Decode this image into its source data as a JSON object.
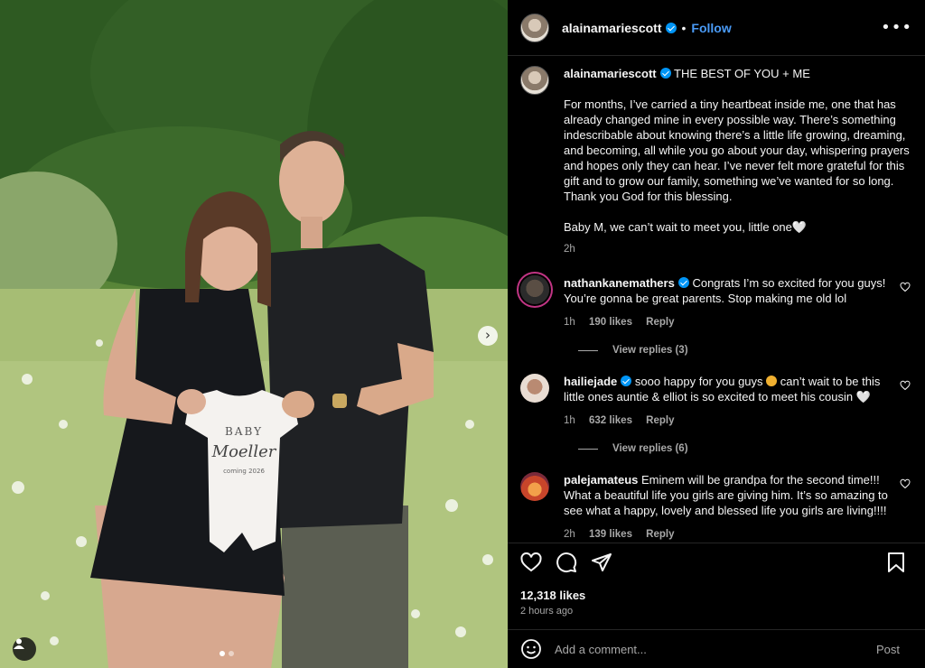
{
  "post": {
    "username": "alainamariescott",
    "follow_label": "Follow",
    "separator": "•",
    "more_label": "•••",
    "caption_title": "THE BEST OF YOU + ME",
    "caption_body": "For months, I’ve carried a tiny heartbeat inside me, one that has already changed mine in every possible way. There’s something indescribable about knowing there’s a little life growing, dreaming, and becoming, all while you go about your day, whispering prayers and hopes only they can hear. I’ve never felt more grateful for this gift and to grow our family, something we’ve wanted for so long. Thank you God for this blessing.\n\nBaby M, we can’t wait to meet you, little one🤍",
    "caption_time": "2h",
    "likes": "12,318 likes",
    "posted_ago": "2 hours ago"
  },
  "photo": {
    "onesie_line1": "BABY",
    "onesie_line2": "Moeller",
    "onesie_line3": "coming 2026",
    "next_arrow": "›"
  },
  "comments": [
    {
      "username": "nathankanemathers",
      "verified": true,
      "text": "Congrats I’m so excited for you guys! You’re gonna be great parents. Stop making me old lol",
      "time": "1h",
      "likes": "190 likes",
      "reply": "Reply",
      "view_replies": "View replies (3)"
    },
    {
      "username": "hailiejade",
      "verified": true,
      "text_a": "sooo happy for you guys",
      "text_b": "can’t wait to be this little ones auntie & elliot is so excited to meet his cousin 🤍",
      "time": "1h",
      "likes": "632 likes",
      "reply": "Reply",
      "view_replies": "View replies (6)"
    },
    {
      "username": "palejamateus",
      "verified": false,
      "text": "Eminem will be grandpa for the second time!!! What a beautiful life you girls are giving him. It’s so amazing to see what a happy, lovely and blessed life you girls are living!!!!",
      "time": "2h",
      "likes": "139 likes",
      "reply": "Reply"
    }
  ],
  "comment_box": {
    "placeholder": "Add a comment...",
    "post_label": "Post"
  },
  "icons": [
    "heart-icon",
    "comment-icon",
    "share-icon",
    "bookmark-icon",
    "emoji-icon",
    "user-tag-icon",
    "verified-icon",
    "more-icon"
  ],
  "colors": {
    "accent": "#4a9bf7",
    "background": "#000000",
    "verified": "#0095f6",
    "muted": "#a8a8a8"
  }
}
